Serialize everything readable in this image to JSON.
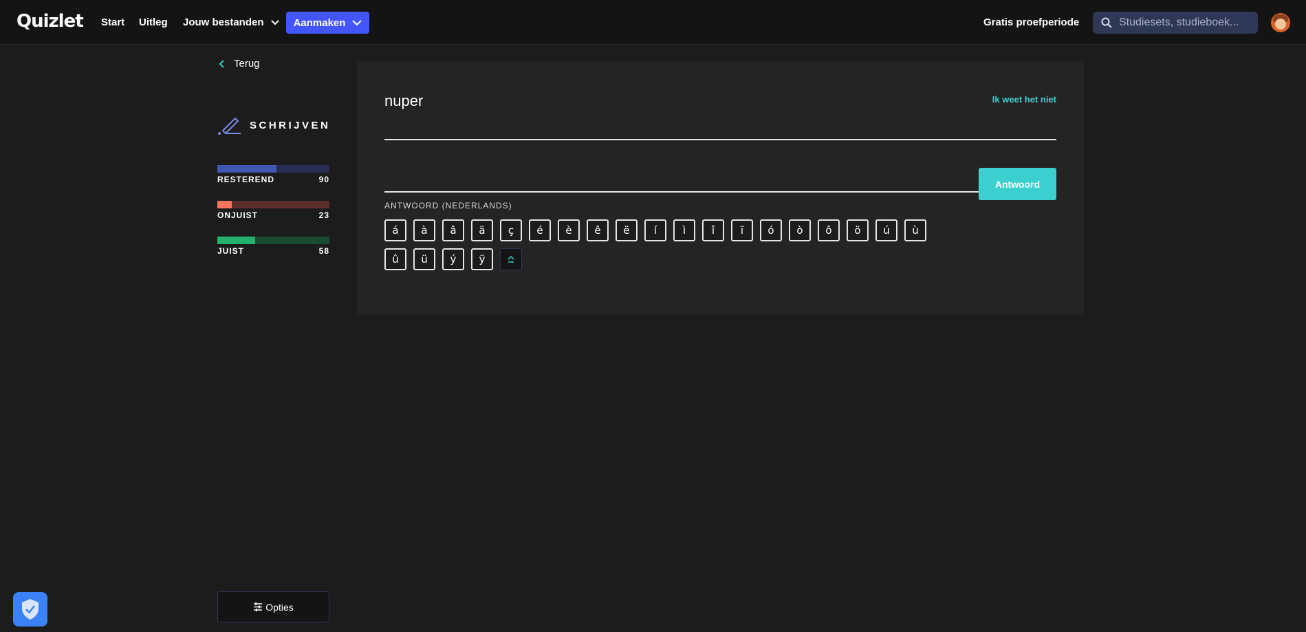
{
  "nav": {
    "logo": "Quizlet",
    "start": "Start",
    "uitleg": "Uitleg",
    "files": "Jouw bestanden",
    "create": "Aanmaken",
    "trial": "Gratis proefperiode",
    "search_placeholder": "Studiesets, studieboek..."
  },
  "sidebar": {
    "back": "Terug",
    "mode": "SCHRIJVEN",
    "stats": [
      {
        "label": "RESTEREND",
        "value": "90",
        "fill": 0.53,
        "color": "#4257b2",
        "track": "#262e52"
      },
      {
        "label": "ONJUIST",
        "value": "23",
        "fill": 0.13,
        "color": "#ff725b",
        "track": "#5b2f29"
      },
      {
        "label": "JUIST",
        "value": "58",
        "fill": 0.34,
        "color": "#23b26d",
        "track": "#1a4a32"
      }
    ],
    "options": "Opties"
  },
  "card": {
    "prompt": "nuper",
    "dont_know": "Ik weet het niet",
    "answer_button": "Antwoord",
    "answer_value": "",
    "language_label": "ANTWOORD (NEDERLANDS)",
    "characters": [
      "á",
      "à",
      "â",
      "ä",
      "ç",
      "é",
      "è",
      "ê",
      "ë",
      "í",
      "ì",
      "î",
      "ï",
      "ó",
      "ò",
      "ô",
      "ö",
      "ú",
      "ù",
      "û",
      "ü",
      "ý",
      "ÿ"
    ]
  },
  "colors": {
    "accent": "#4255ff",
    "teal": "#3ccfcf",
    "background": "#1c1c1c"
  }
}
